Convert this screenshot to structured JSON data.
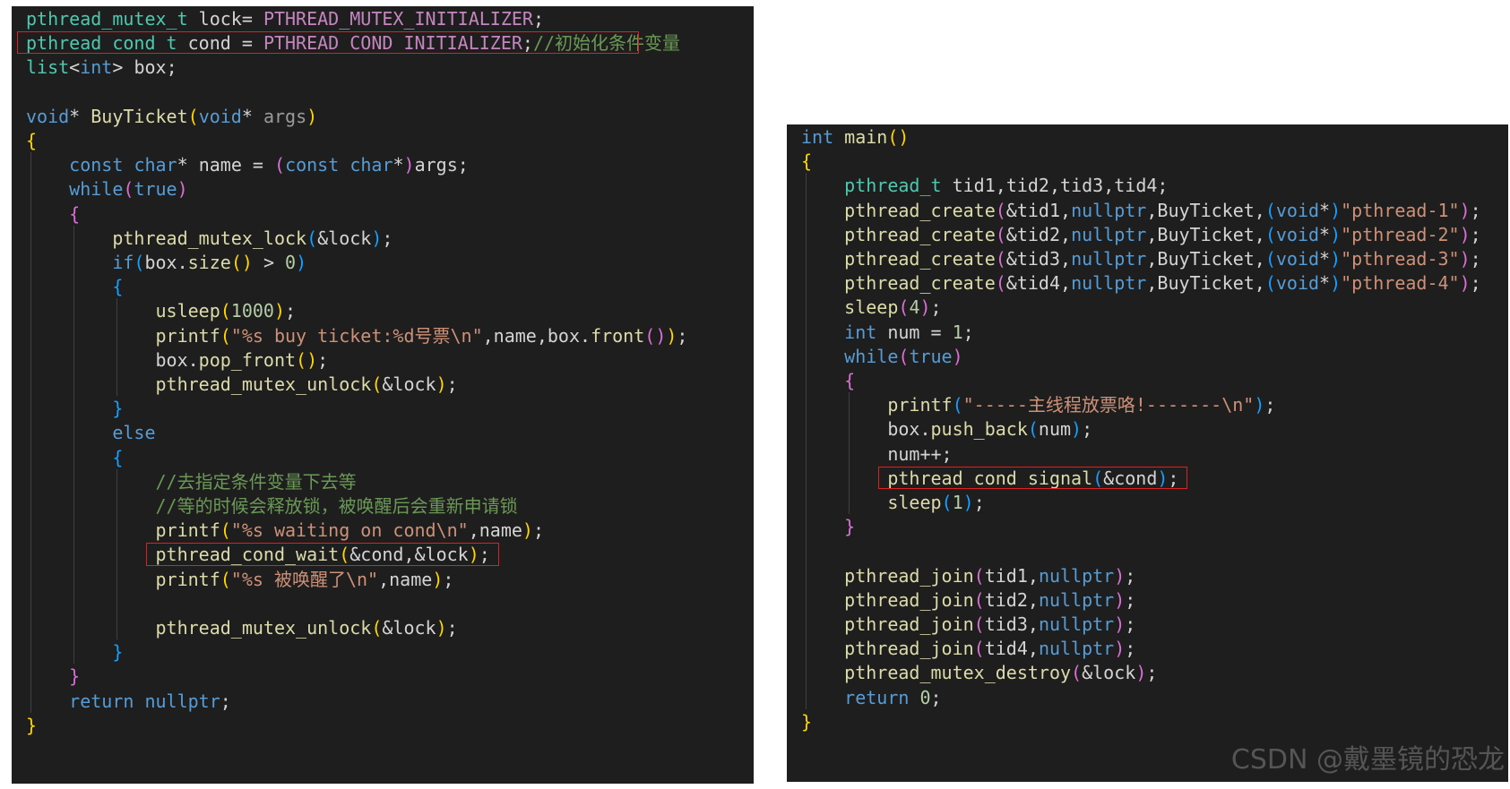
{
  "left_panel": {
    "lines": [
      "pthread_mutex_t lock= PTHREAD_MUTEX_INITIALIZER;",
      "pthread_cond_t cond = PTHREAD_COND_INITIALIZER;//初始化条件变量",
      "list<int> box;",
      "",
      "void* BuyTicket(void* args)",
      "{",
      "    const char* name = (const char*)args;",
      "    while(true)",
      "    {",
      "        pthread_mutex_lock(&lock);",
      "        if(box.size() > 0)",
      "        {",
      "            usleep(1000);",
      "            printf(\"%s buy ticket:%d号票\\n\",name,box.front());",
      "            box.pop_front();",
      "            pthread_mutex_unlock(&lock);",
      "        }",
      "        else",
      "        {",
      "            //去指定条件变量下去等",
      "            //等的时候会释放锁，被唤醒后会重新申请锁",
      "            printf(\"%s waiting on cond\\n\",name);",
      "            pthread_cond_wait(&cond,&lock);",
      "            printf(\"%s 被唤醒了\\n\",name);",
      "",
      "            pthread_mutex_unlock(&lock);",
      "        }",
      "    }",
      "    return nullptr;",
      "}"
    ],
    "highlighted_lines": [
      1,
      22
    ]
  },
  "right_panel": {
    "lines": [
      "int main()",
      "{",
      "    pthread_t tid1,tid2,tid3,tid4;",
      "    pthread_create(&tid1,nullptr,BuyTicket,(void*)\"pthread-1\");",
      "    pthread_create(&tid2,nullptr,BuyTicket,(void*)\"pthread-2\");",
      "    pthread_create(&tid3,nullptr,BuyTicket,(void*)\"pthread-3\");",
      "    pthread_create(&tid4,nullptr,BuyTicket,(void*)\"pthread-4\");",
      "    sleep(4);",
      "    int num = 1;",
      "    while(true)",
      "    {",
      "        printf(\"-----主线程放票咯!-------\\n\");",
      "        box.push_back(num);",
      "        num++;",
      "        pthread_cond_signal(&cond);",
      "        sleep(1);",
      "    }",
      "",
      "    pthread_join(tid1,nullptr);",
      "    pthread_join(tid2,nullptr);",
      "    pthread_join(tid3,nullptr);",
      "    pthread_join(tid4,nullptr);",
      "    pthread_mutex_destroy(&lock);",
      "    return 0;",
      "}"
    ],
    "highlighted_lines": [
      14
    ]
  },
  "watermark": "CSDN @戴墨镜的恐龙",
  "colors": {
    "editor_background": "#1e1e1e",
    "highlight_border": "#e02020",
    "type": "#4ec9b0",
    "keyword": "#569cd6",
    "function": "#dcdcaa",
    "string": "#ce9178",
    "comment": "#6a9955",
    "number": "#b5cea8",
    "macro": "#c586c0"
  }
}
